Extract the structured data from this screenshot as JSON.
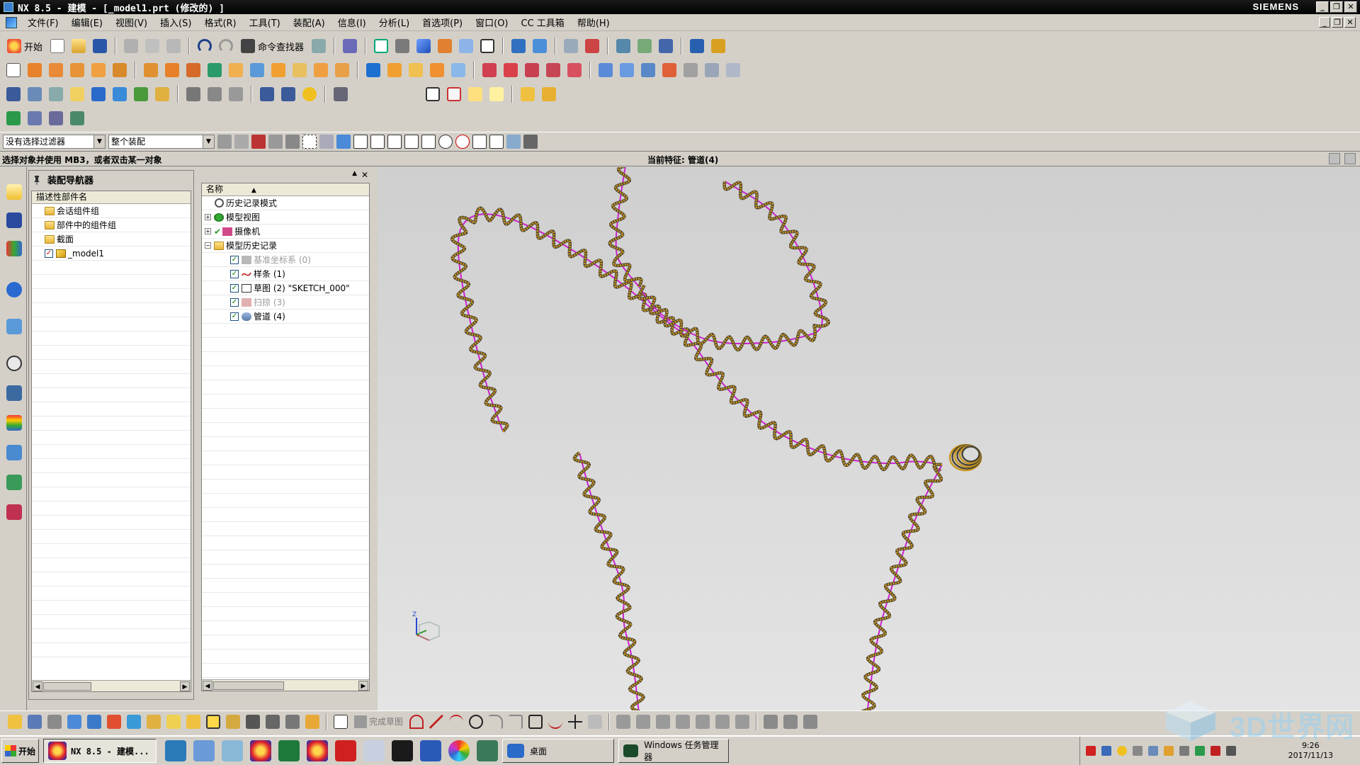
{
  "window": {
    "title": "NX 8.5 - 建模 - [_model1.prt  (修改的) ]",
    "brand": "SIEMENS",
    "controls": [
      "_",
      "❐",
      "✕"
    ]
  },
  "menubar": {
    "items": [
      "文件(F)",
      "编辑(E)",
      "视图(V)",
      "插入(S)",
      "格式(R)",
      "工具(T)",
      "装配(A)",
      "信息(I)",
      "分析(L)",
      "首选项(P)",
      "窗口(O)",
      "CC 工具箱",
      "帮助(H)"
    ]
  },
  "toolbar": {
    "start_label": "开始",
    "cmd_finder_label": "命令查找器"
  },
  "selection": {
    "filter_value": "没有选择过滤器",
    "scope_value": "整个装配"
  },
  "status": {
    "prompt": "选择对象并使用 MB3，或者双击某一对象",
    "current_feature": "当前特征: 管道(4)"
  },
  "assembly_navigator": {
    "title": "装配导航器",
    "column": "描述性部件名",
    "rows": [
      {
        "label": "会话组件组",
        "icon": "folder-icon"
      },
      {
        "label": "部件中的组件组",
        "icon": "folder-icon"
      },
      {
        "label": "截面",
        "icon": "folder-icon"
      },
      {
        "label": "_model1",
        "icon": "part-icon"
      }
    ]
  },
  "part_navigator": {
    "column": "名称",
    "rows": [
      {
        "label": "历史记录模式",
        "icon": "clock-icon"
      },
      {
        "label": "模型视图",
        "icon": "view-icon"
      },
      {
        "label": "摄像机",
        "icon": "camera-icon"
      },
      {
        "label": "模型历史记录",
        "icon": "folder-icon"
      },
      {
        "label": "基准坐标系 (0)",
        "icon": "csys-icon",
        "dim": true
      },
      {
        "label": "样条 (1)",
        "icon": "spline-icon",
        "dim": false
      },
      {
        "label": "草图 (2) \"SKETCH_000\"",
        "icon": "sketch-icon",
        "dim": false
      },
      {
        "label": "扫掠 (3)",
        "icon": "sweep-icon",
        "dim": true
      },
      {
        "label": "管道 (4)",
        "icon": "tube-icon",
        "dim": false
      }
    ]
  },
  "bottom_toolbar": {
    "finish_sketch_label": "完成草图"
  },
  "taskbar": {
    "start_label": "开始",
    "active_task": "NX 8.5 - 建模...",
    "desktop_label": "桌面",
    "task_manager_label": "Windows 任务管理器",
    "clock_time": "9:26",
    "clock_date": "2017/11/13"
  },
  "watermark": {
    "text": "3D世界网"
  },
  "colors": {
    "path_curve": "#cc22cc",
    "helix_wire": "#c9961e",
    "helix_dark": "#4a4436"
  }
}
